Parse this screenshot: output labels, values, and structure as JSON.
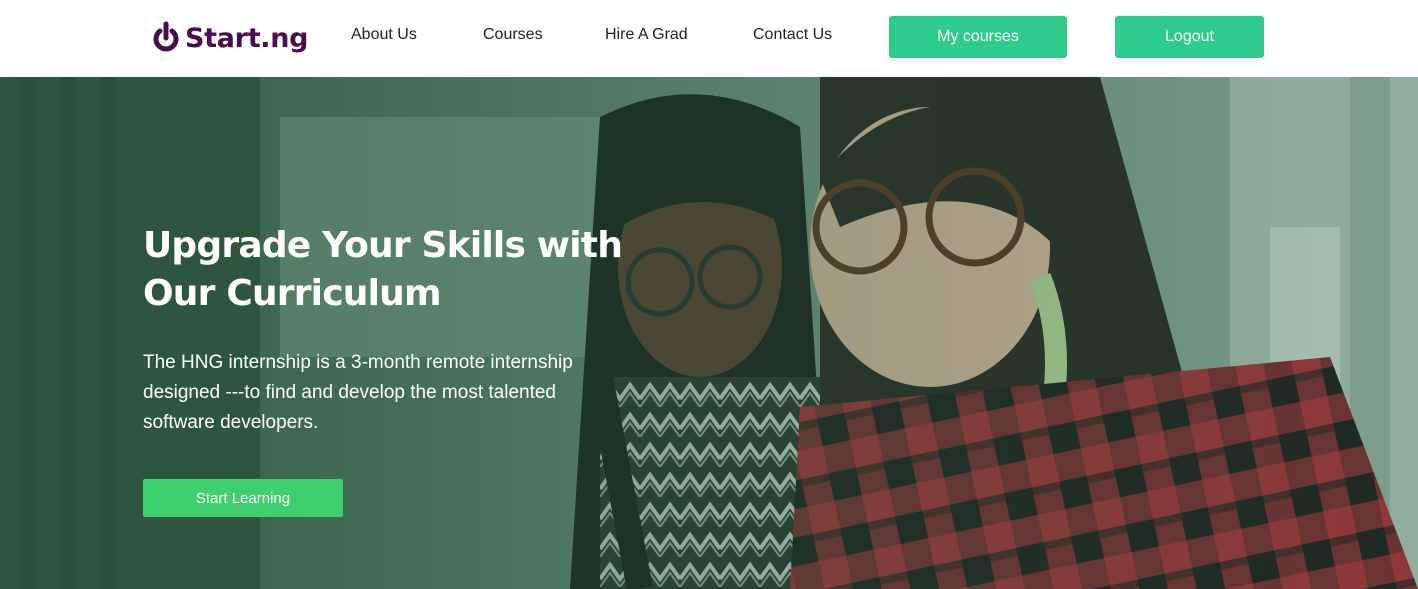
{
  "brand": {
    "name": "Start.ng",
    "logo_icon": "power-icon",
    "color": "#4b0d4f"
  },
  "nav": {
    "about": "About Us",
    "courses": "Courses",
    "hire": "Hire A Grad",
    "contact": "Contact Us"
  },
  "actions": {
    "my_courses": "My courses",
    "logout": "Logout",
    "accent_color": "#2ecc8a"
  },
  "hero": {
    "title_line1": "Upgrade Your Skills with",
    "title_line2": "Our Curriculum",
    "description": "The HNG internship is a 3-month remote internship designed ---to find and develop the most talented software developers.",
    "cta": "Start Learning",
    "cta_color": "#3ecf6e"
  }
}
